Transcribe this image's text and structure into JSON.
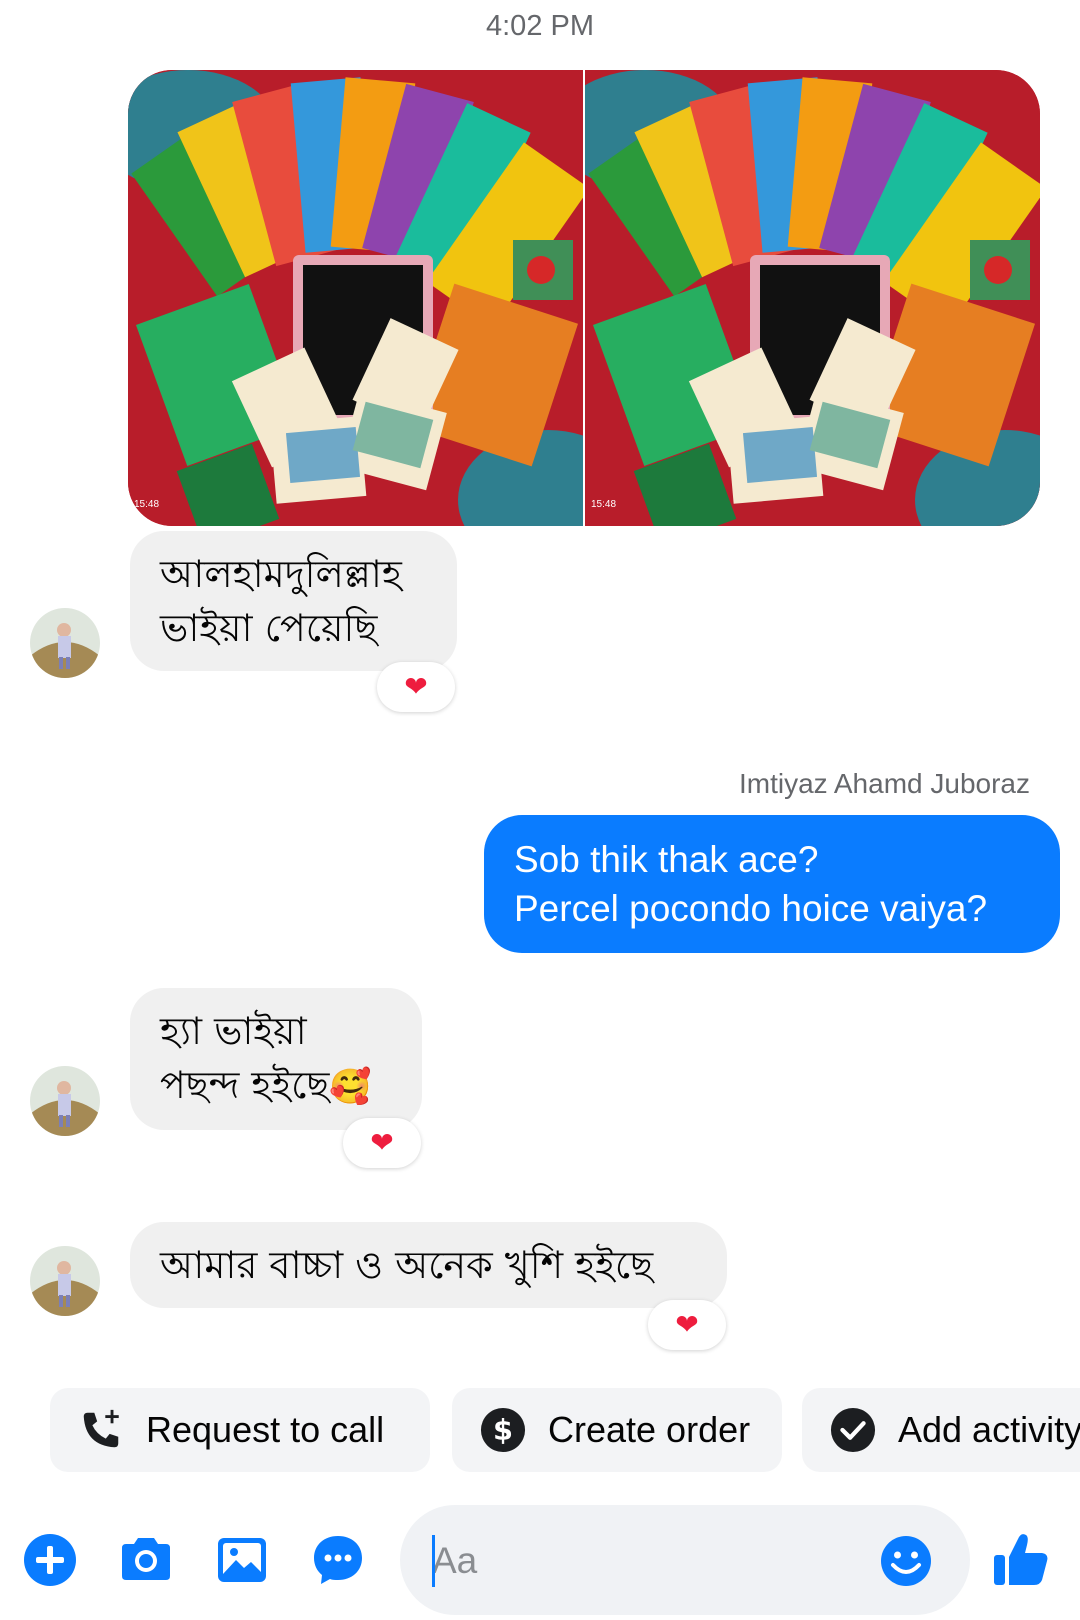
{
  "thread": {
    "timestamp": "4:02 PM",
    "photos": [
      {
        "time_label": "15:48"
      },
      {
        "time_label": "15:48"
      }
    ],
    "messages": [
      {
        "line1": "আলহামদুলিল্লাহ",
        "line2": "ভাইয়া পেয়েছি",
        "reaction": "❤"
      },
      {
        "sender": "Imtiyaz Ahamd Juboraz",
        "line1": "Sob thik thak ace?",
        "line2": "Percel pocondo hoice vaiya?"
      },
      {
        "line1": "হ্যা ভাইয়া",
        "line2": "পছন্দ হইছে",
        "emoji": "🥰",
        "reaction": "❤"
      },
      {
        "line1": "আমার  বাচ্চা ও অনেক খুশি হইছে",
        "reaction": "❤"
      }
    ]
  },
  "quick_actions": [
    {
      "label": "Request to call",
      "icon": "phone-plus-icon"
    },
    {
      "label": "Create order",
      "icon": "dollar-icon"
    },
    {
      "label": "Add activity",
      "icon": "check-circle-icon"
    }
  ],
  "composer": {
    "placeholder": "Aa"
  },
  "colors": {
    "accent": "#0a7cff",
    "incoming_bubble": "#f0f0f0",
    "reaction_heart": "#ee1d3e"
  }
}
